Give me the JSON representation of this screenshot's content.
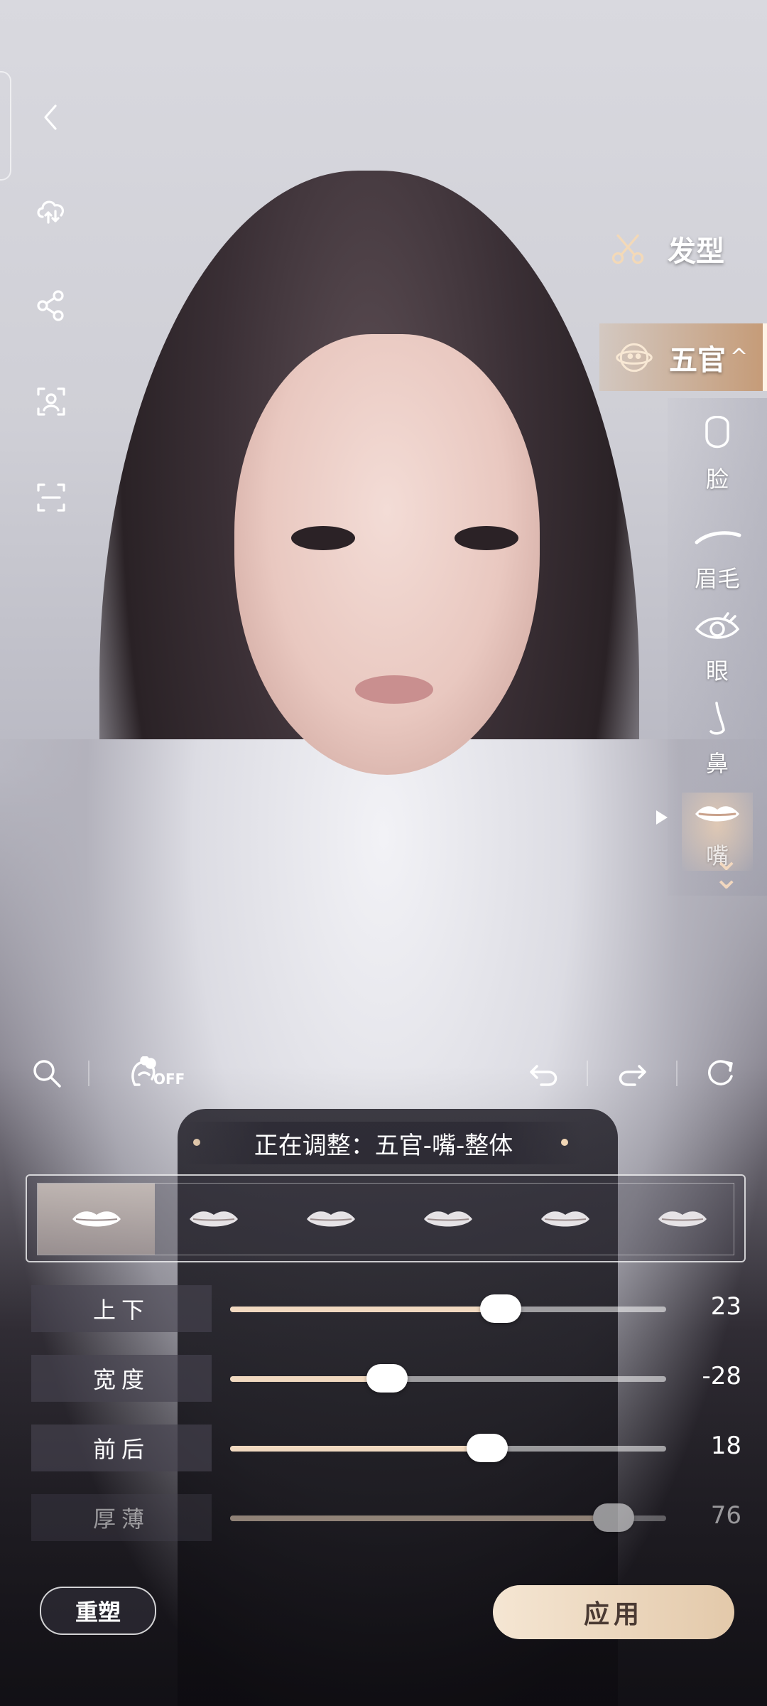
{
  "categories": {
    "hair": {
      "label": "发型",
      "icon": "scissors-icon"
    },
    "features": {
      "label": "五官",
      "icon": "face-globe-icon",
      "expanded": true
    }
  },
  "sub_categories": [
    {
      "label": "脸",
      "icon": "face-outline-icon"
    },
    {
      "label": "眉毛",
      "icon": "eyebrow-icon"
    },
    {
      "label": "眼",
      "icon": "eye-icon"
    },
    {
      "label": "鼻",
      "icon": "nose-icon"
    },
    {
      "label": "嘴",
      "icon": "lips-icon",
      "active": true
    }
  ],
  "toolbar": {
    "off_label": "OFF"
  },
  "adjusting": "正在调整：五官-嘴-整体",
  "presets": [
    {
      "icon": "lips-preset-icon",
      "selected": true
    },
    {
      "icon": "lips-preset-icon"
    },
    {
      "icon": "lips-preset-icon"
    },
    {
      "icon": "lips-preset-icon"
    },
    {
      "icon": "lips-preset-icon"
    },
    {
      "icon": "lips-preset-icon"
    }
  ],
  "sliders": [
    {
      "label": "上下",
      "value": "23",
      "level": 0.62
    },
    {
      "label": "宽度",
      "value": "-28",
      "level": 0.36
    },
    {
      "label": "前后",
      "value": "18",
      "level": 0.59
    },
    {
      "label": "厚薄",
      "value": "76",
      "level": 0.88
    }
  ],
  "buttons": {
    "reset": "重塑",
    "apply": "应用"
  },
  "colors": {
    "accent": "#e3c9aa",
    "slider_fill": "#f1d9c0"
  }
}
